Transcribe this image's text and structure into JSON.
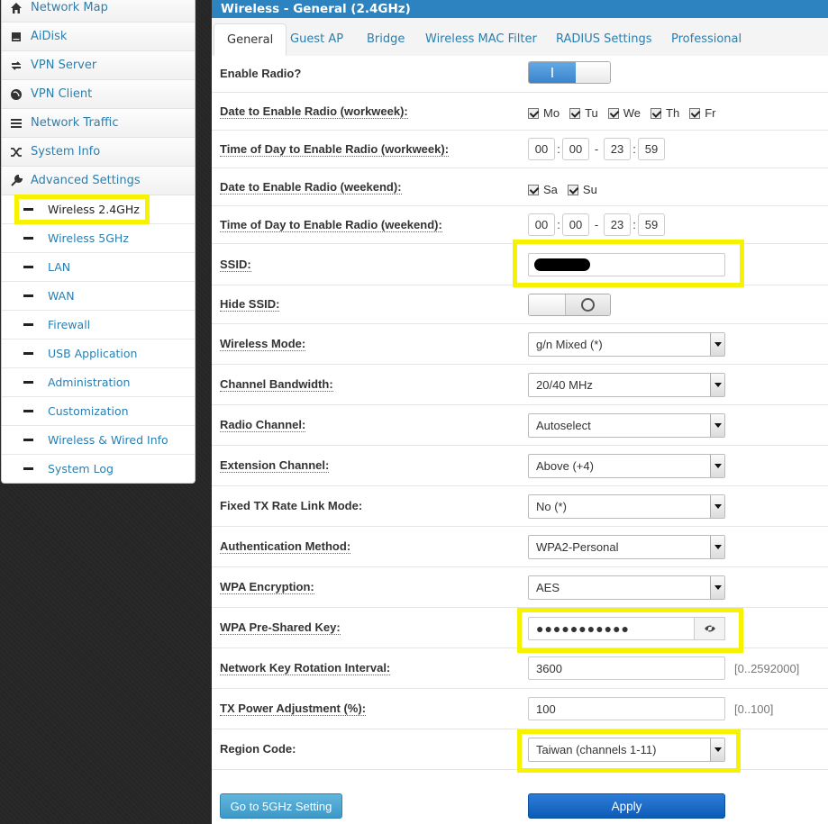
{
  "sidebar": {
    "items": [
      {
        "label": "Network Map",
        "icon": "home-icon"
      },
      {
        "label": "AiDisk",
        "icon": "disk-icon"
      },
      {
        "label": "VPN Server",
        "icon": "vpn-icon"
      },
      {
        "label": "VPN Client",
        "icon": "globe-icon"
      },
      {
        "label": "Network Traffic",
        "icon": "list-icon"
      },
      {
        "label": "System Info",
        "icon": "shuffle-icon"
      },
      {
        "label": "Advanced Settings",
        "icon": "wrench-icon"
      }
    ],
    "subitems": [
      "Wireless 2.4GHz",
      "Wireless 5GHz",
      "LAN",
      "WAN",
      "Firewall",
      "USB Application",
      "Administration",
      "Customization",
      "Wireless & Wired Info",
      "System Log"
    ]
  },
  "header": {
    "title": "Wireless - General (2.4GHz)"
  },
  "tabs": [
    "General",
    "Guest AP",
    "Bridge",
    "Wireless MAC Filter",
    "RADIUS Settings",
    "Professional"
  ],
  "form": {
    "enable_radio": {
      "label": "Enable Radio?",
      "on_glyph": "I"
    },
    "workweek_days": {
      "label": "Date to Enable Radio (workweek):",
      "days": [
        "Mo",
        "Tu",
        "We",
        "Th",
        "Fr"
      ]
    },
    "workweek_time": {
      "label": "Time of Day to Enable Radio (workweek):",
      "start_h": "00",
      "start_m": "00",
      "end_h": "23",
      "end_m": "59"
    },
    "weekend_days": {
      "label": "Date to Enable Radio (weekend):",
      "days": [
        "Sa",
        "Su"
      ]
    },
    "weekend_time": {
      "label": "Time of Day to Enable Radio (weekend):",
      "start_h": "00",
      "start_m": "00",
      "end_h": "23",
      "end_m": "59"
    },
    "colon": ":",
    "dash": "-",
    "ssid": {
      "label": "SSID:"
    },
    "hide_ssid": {
      "label": "Hide SSID:"
    },
    "wireless_mode": {
      "label": "Wireless Mode:",
      "value": "g/n Mixed (*)"
    },
    "channel_bandwidth": {
      "label": "Channel Bandwidth:",
      "value": "20/40 MHz"
    },
    "radio_channel": {
      "label": "Radio Channel:",
      "value": "Autoselect"
    },
    "extension_channel": {
      "label": "Extension Channel:",
      "value": "Above (+4)"
    },
    "fixed_tx": {
      "label": "Fixed TX Rate Link Mode:",
      "value": "No (*)"
    },
    "auth_method": {
      "label": "Authentication Method:",
      "value": "WPA2-Personal"
    },
    "wpa_encryption": {
      "label": "WPA Encryption:",
      "value": "AES"
    },
    "wpa_psk": {
      "label": "WPA Pre-Shared Key:",
      "value": "●●●●●●●●●●●"
    },
    "key_rotation": {
      "label": "Network Key Rotation Interval:",
      "value": "3600",
      "range": "[0..2592000]"
    },
    "tx_power": {
      "label": "TX Power Adjustment (%):",
      "value": "100",
      "range": "[0..100]"
    },
    "region": {
      "label": "Region Code:",
      "value": "Taiwan (channels 1-11)"
    }
  },
  "buttons": {
    "goto5g": "Go to 5GHz Setting",
    "apply": "Apply"
  },
  "colors": {
    "accent": "#2d83bf",
    "highlight": "#f7f200",
    "apply": "#0d5bb8"
  }
}
